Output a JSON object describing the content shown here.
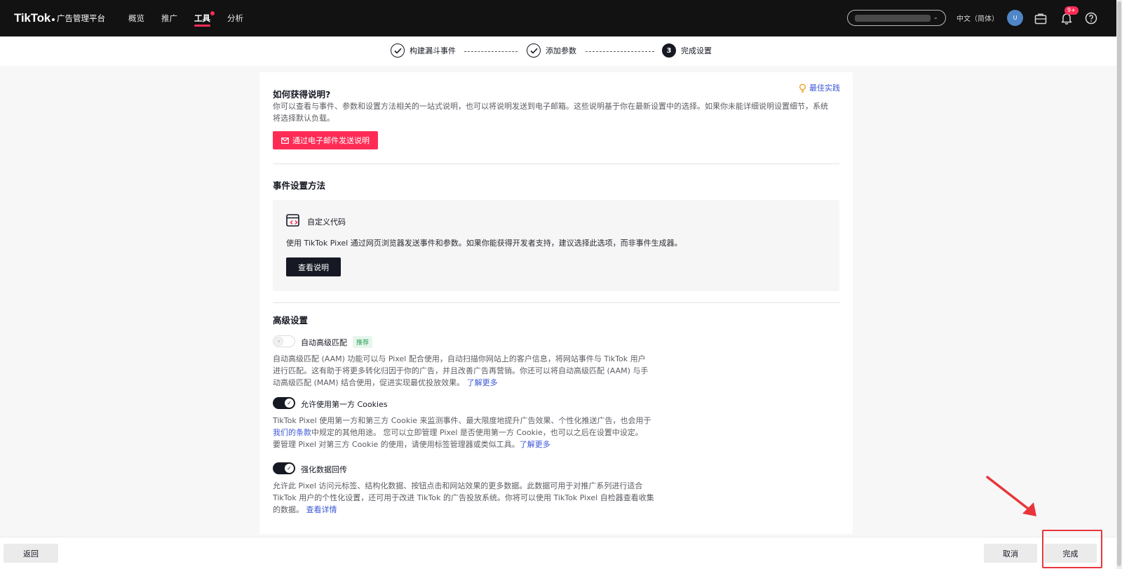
{
  "header": {
    "brand": "TikTok",
    "brand_sub": "广告管理平台",
    "nav": [
      {
        "label": "概览"
      },
      {
        "label": "推广"
      },
      {
        "label": "工具"
      },
      {
        "label": "分析"
      }
    ],
    "language": "中文（简体）",
    "avatar_initial": "U",
    "notification_count": "9+"
  },
  "stepper": {
    "steps": [
      {
        "label": "构建漏斗事件",
        "state": "done"
      },
      {
        "label": "添加参数",
        "state": "done"
      },
      {
        "label": "完成设置",
        "state": "current",
        "number": "3"
      }
    ]
  },
  "instructions": {
    "title": "如何获得说明?",
    "best_practice": "最佳实践",
    "description": "你可以查看与事件、参数和设置方法相关的一站式说明，也可以将说明发送到电子邮箱。这些说明基于你在最新设置中的选择。如果你未能详细说明设置细节，系统将选择默认负载。",
    "email_button": "通过电子邮件发送说明"
  },
  "event_method": {
    "title": "事件设置方法",
    "option_title": "自定义代码",
    "option_desc": "使用 TikTok Pixel 通过网页浏览器发送事件和参数。如果你能获得开发者支持，建议选择此选项，而非事件生成器。",
    "view_button": "查看说明"
  },
  "advanced": {
    "title": "高级设置",
    "aam": {
      "label": "自动高级匹配",
      "tag": "推荐",
      "enabled": false,
      "desc_line1": "自动高级匹配 (AAM) 功能可以与 Pixel 配合使用，自动扫描你网站上的客户信息，将网站事件与 TikTok 用户",
      "desc_line2": "进行匹配。这有助于将更多转化归因于你的广告，并且改善广告再营销。你还可以将自动高级匹配 (AAM) 与手",
      "desc_line3": "动高级匹配 (MAM) 结合使用，促进实现最优投放效果。",
      "link": "了解更多"
    },
    "cookies": {
      "label": "允许使用第一方 Cookies",
      "enabled": true,
      "desc_line1": "TikTok Pixel 使用第一方和第三方 Cookie 来监测事件、最大限度地提升广告效果、个性化推送广告，也会用于",
      "terms_link": "我们的条款",
      "desc_line2": "中规定的其他用途。 您可以立即管理 Pixel 是否使用第一方 Cookie，也可以之后在设置中设定。",
      "desc_line3": "要管理 Pixel 对第三方 Cookie 的使用，请使用标签管理器或类似工具。",
      "link": "了解更多"
    },
    "enhanced": {
      "label": "强化数据回传",
      "enabled": true,
      "desc_line1": "允许此 Pixel 访问元标签、结构化数据、按钮点击和网站效果的更多数据。此数据可用于对推广系列进行适合",
      "desc_line2": "TikTok 用户的个性化设置，还可用于改进 TikTok 的广告投放系统。你将可以使用 TikTok Pixel 自检器查看收集",
      "desc_line3": "的数据。",
      "link": "查看详情"
    }
  },
  "footer": {
    "back": "返回",
    "cancel": "取消",
    "finish": "完成"
  },
  "colors": {
    "brand_red": "#fe2c55",
    "link_blue": "#3a56d4",
    "dark": "#161823",
    "annotation_red": "#e8363a"
  }
}
